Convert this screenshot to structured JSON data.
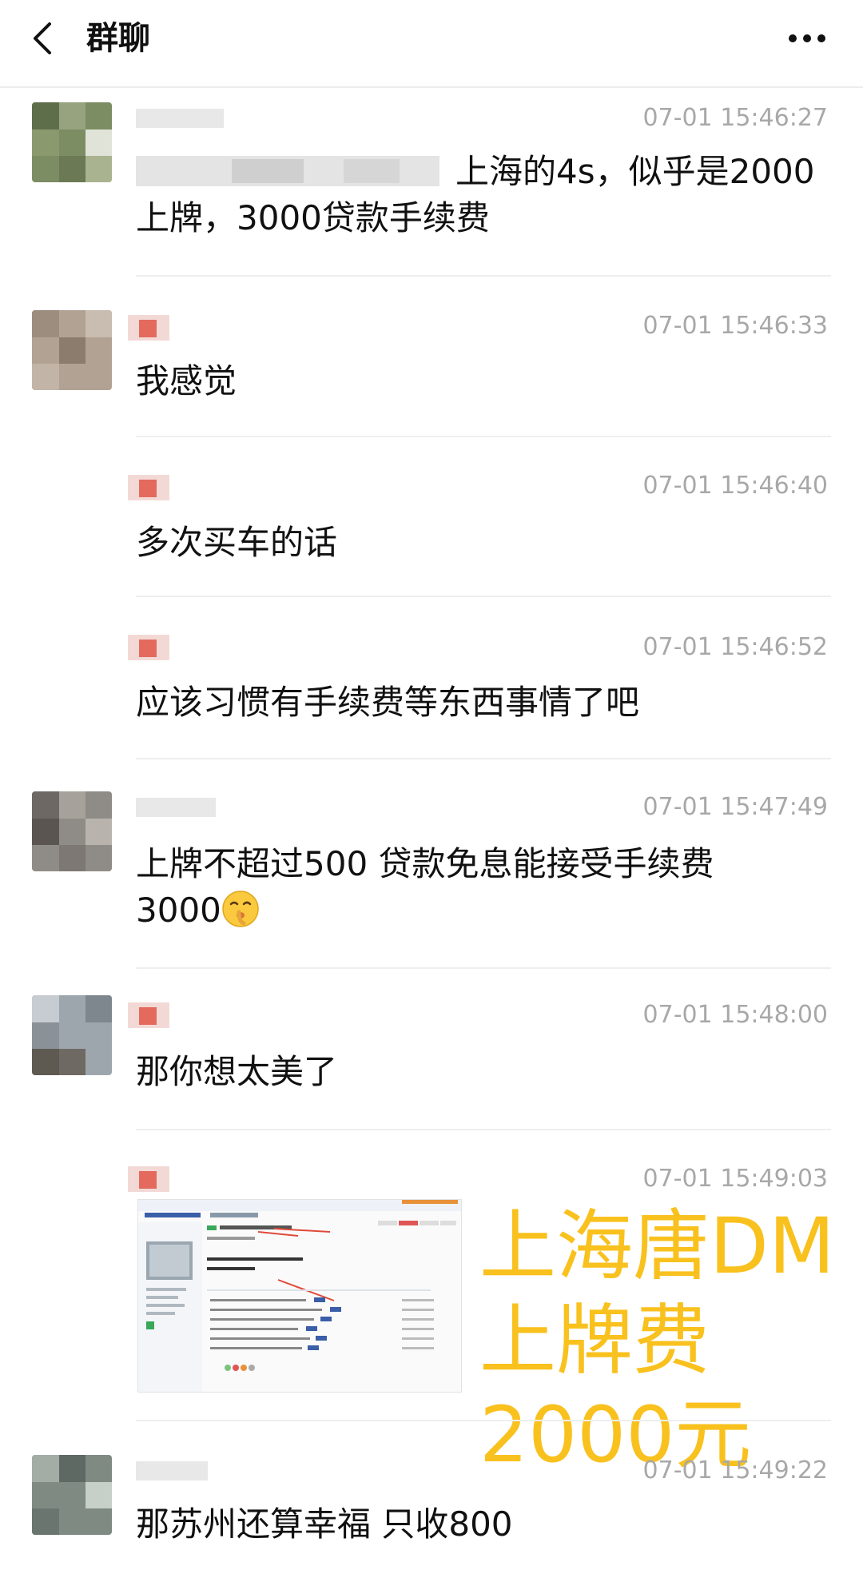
{
  "header": {
    "title": "群聊",
    "back_icon": "chevron-left-icon",
    "more_icon": "more-dots-icon"
  },
  "messages": [
    {
      "time": "07-01 15:46:27",
      "line1": "上海的4s，似乎是2000",
      "line2": "上牌，3000贷款手续费"
    },
    {
      "time": "07-01 15:46:33",
      "text": "我感觉"
    },
    {
      "time": "07-01 15:46:40",
      "text": "多次买车的话"
    },
    {
      "time": "07-01 15:46:52",
      "text": "应该习惯有手续费等东西事情了吧"
    },
    {
      "time": "07-01 15:47:49",
      "line1": "上牌不超过500   贷款免息能接受手续费",
      "line2": "3000",
      "emoji": "shushing-face-emoji"
    },
    {
      "time": "07-01 15:48:00",
      "text": "那你想太美了"
    },
    {
      "time": "07-01 15:49:03",
      "image": "forum-screenshot"
    },
    {
      "time": "07-01 15:49:22",
      "text": "那苏州还算幸福 只收800"
    }
  ],
  "watermark": {
    "line1": "上海唐DM",
    "line2": "上牌费",
    "line3": "2000元",
    "color": "#f9c11e"
  }
}
